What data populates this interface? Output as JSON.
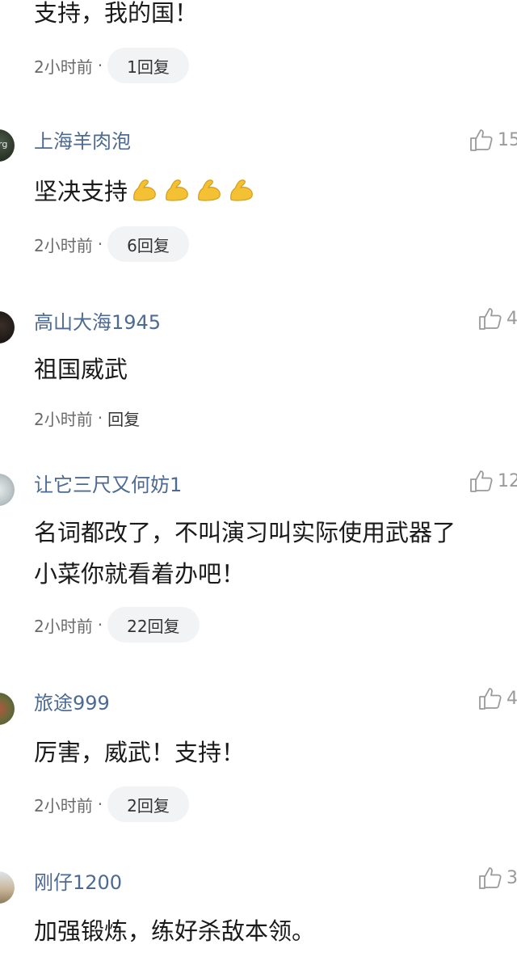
{
  "comments": [
    {
      "username": "",
      "likes": "",
      "text": "支持，我的国！",
      "time": "2小时前",
      "reply": "1回复"
    },
    {
      "username": "上海羊肉泡",
      "likes": "15",
      "text": "坚决支持",
      "emoji": "flexed-biceps-emoji",
      "emoji_count": 4,
      "time": "2小时前",
      "reply": "6回复"
    },
    {
      "username": "高山大海1945",
      "likes": "4",
      "text": "祖国威武",
      "time": "2小时前",
      "reply": "回复"
    },
    {
      "username": "让它三尺又何妨1",
      "likes": "12",
      "text_line1": "名词都改了，不叫演习叫实际使用武器了",
      "text_line2": "小菜你就看着办吧！",
      "time": "2小时前",
      "reply": "22回复"
    },
    {
      "username": "旅途999",
      "likes": "4",
      "text": "厉害，威武！支持！",
      "time": "2小时前",
      "reply": "2回复"
    },
    {
      "username": "刚仔1200",
      "likes": "3",
      "text": "加强锻炼，练好杀敌本领。"
    }
  ],
  "separator": "·",
  "colors": {
    "username": "#4c6a92",
    "meta": "#6a6a6a",
    "pill_bg": "#f2f3f5",
    "like_icon": "#9a9a9a"
  },
  "icons": {
    "like": "thumbs-up-outline-icon",
    "emoji": "flexed-biceps-emoji"
  }
}
